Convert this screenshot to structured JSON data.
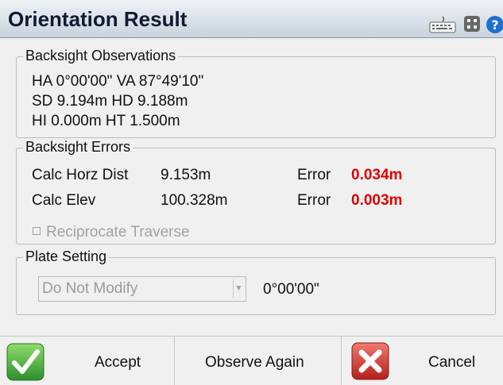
{
  "window": {
    "title": "Orientation Result",
    "toolbar_icons": [
      "keyboard-icon",
      "calculator-icon",
      "help-icon"
    ]
  },
  "backsight_observations": {
    "label": "Backsight Observations",
    "lines": [
      "HA 0°00'00\"  VA 87°49'10\"",
      "SD 9.194m  HD 9.188m",
      "HI 0.000m  HT 1.500m"
    ]
  },
  "backsight_errors": {
    "label": "Backsight Errors",
    "rows": [
      {
        "label": "Calc Horz Dist",
        "value": "9.153m",
        "error_label": "Error",
        "error_value": "0.034m"
      },
      {
        "label": "Calc Elev",
        "value": "100.328m",
        "error_label": "Error",
        "error_value": "0.003m"
      }
    ],
    "reciprocate_label": "Reciprocate Traverse",
    "reciprocate_checked": false
  },
  "plate_setting": {
    "label": "Plate Setting",
    "selected": "Do Not Modify",
    "value": "0°00'00\""
  },
  "buttons": {
    "accept": "Accept",
    "observe_again": "Observe Again",
    "cancel": "Cancel"
  },
  "colors": {
    "error_value": "#e00000",
    "accept_icon": "#3aa83a",
    "cancel_icon": "#d8342c"
  }
}
